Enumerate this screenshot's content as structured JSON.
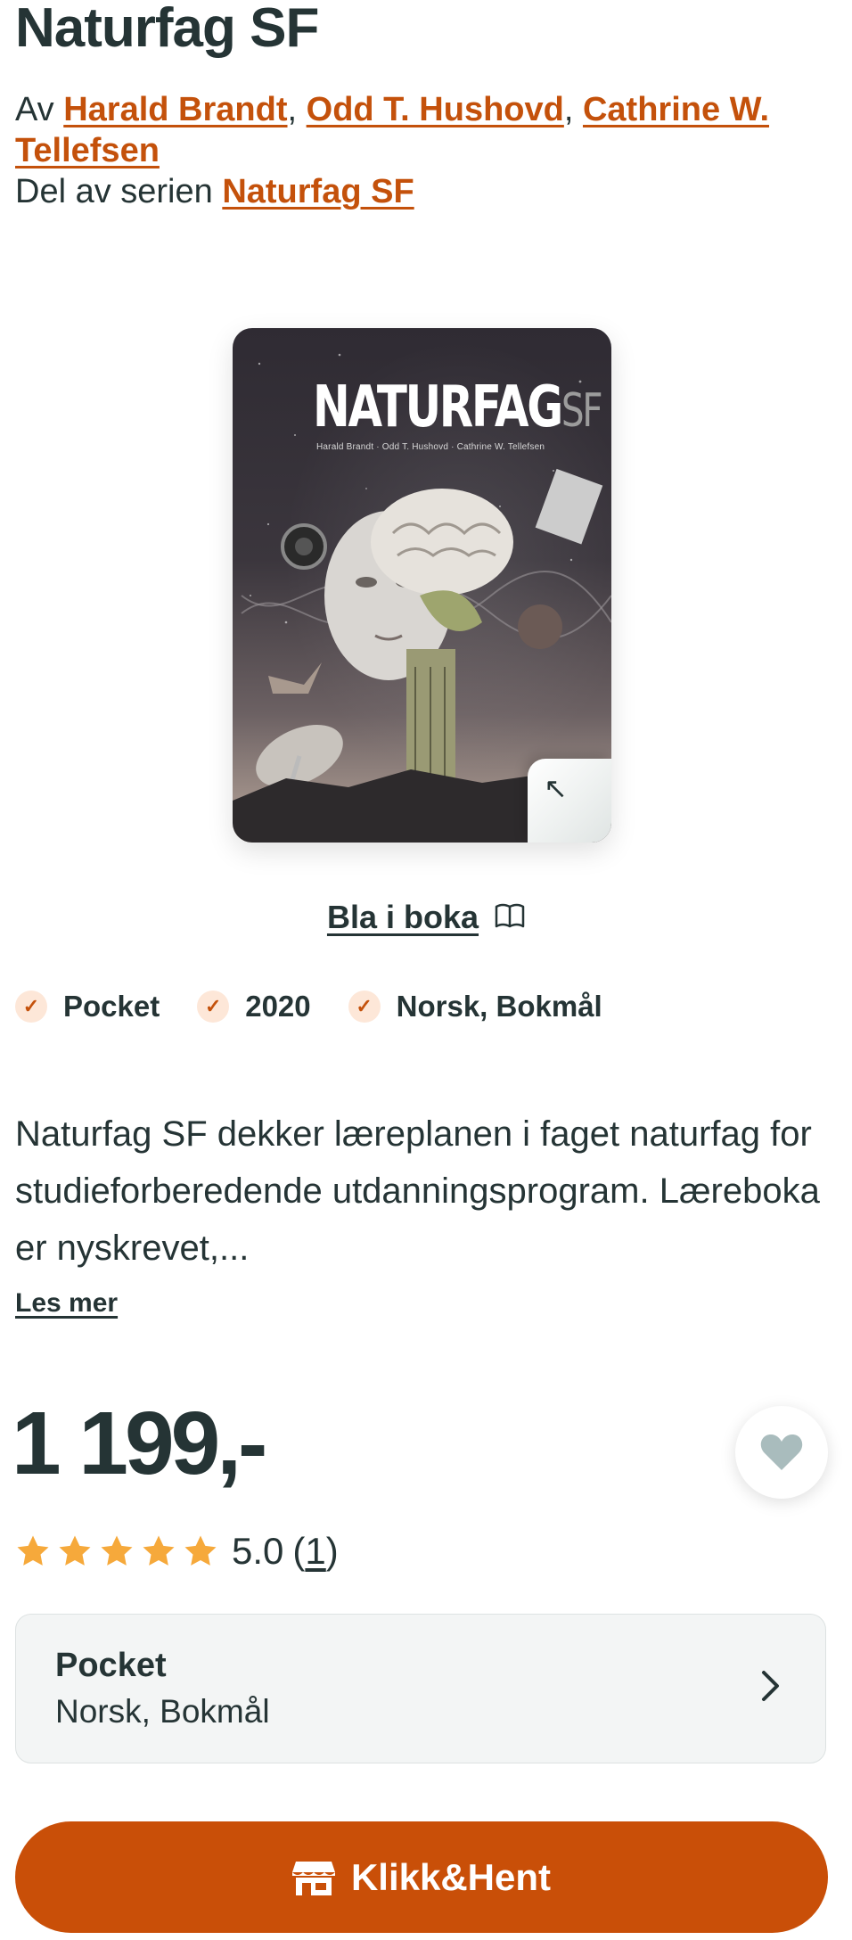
{
  "product": {
    "title": "Naturfag SF",
    "authors_prefix": "Av",
    "authors": [
      "Harald Brandt",
      "Odd T. Hushovd",
      "Cathrine W. Tellefsen"
    ],
    "series_prefix": "Del av serien",
    "series": "Naturfag SF"
  },
  "cover": {
    "title_main": "NATURFAG",
    "title_suffix": "SF",
    "authors_line": "Harald Brandt · Odd T. Hushovd · Cathrine W. Tellefsen",
    "expand_icon": "expand-arrow-icon"
  },
  "browse": {
    "label": "Bla i boka",
    "icon": "open-book-icon"
  },
  "chips": [
    {
      "label": "Pocket",
      "icon": "check-icon"
    },
    {
      "label": "2020",
      "icon": "check-icon"
    },
    {
      "label": "Norsk, Bokmål",
      "icon": "check-icon"
    }
  ],
  "description": {
    "text": "Naturfag SF dekker læreplanen i faget naturfag for studieforberedende utdanningsprogram. Læreboka er nyskrevet,...",
    "more_label": "Les mer"
  },
  "pricing": {
    "price": "1 199,-",
    "favorite_icon": "heart-icon",
    "rating_score": "5.0",
    "rating_count_open": "(",
    "rating_count": "1",
    "rating_count_close": ")",
    "stars": 5
  },
  "format_selector": {
    "format": "Pocket",
    "language": "Norsk, Bokmål",
    "icon": "chevron-right-icon"
  },
  "cta": {
    "label": "Klikk&Hent",
    "icon": "store-icon"
  },
  "colors": {
    "accent": "#c4510b",
    "cta": "#c94f08",
    "text": "#253435",
    "star": "#f6a93b",
    "chip_bg": "#fde7d8",
    "card_bg": "#f3f5f5"
  }
}
